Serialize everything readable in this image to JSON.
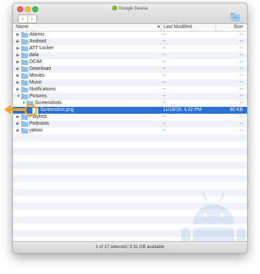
{
  "window": {
    "title": "Google Device"
  },
  "header": {
    "name_label": "Name",
    "modified_label": "Last Modified",
    "size_label": "Size"
  },
  "rows": [
    {
      "name": "Alarms",
      "modified": "--",
      "size": "--",
      "type": "folder",
      "level": 0
    },
    {
      "name": "Android",
      "modified": "--",
      "size": "--",
      "type": "folder",
      "level": 0
    },
    {
      "name": "ATT Locker",
      "modified": "--",
      "size": "--",
      "type": "folder",
      "level": 0
    },
    {
      "name": "data",
      "modified": "--",
      "size": "--",
      "type": "folder",
      "level": 0
    },
    {
      "name": "DCIM",
      "modified": "--",
      "size": "--",
      "type": "folder",
      "level": 0
    },
    {
      "name": "Download",
      "modified": "--",
      "size": "--",
      "type": "folder",
      "level": 0
    },
    {
      "name": "Movies",
      "modified": "--",
      "size": "--",
      "type": "folder",
      "level": 0
    },
    {
      "name": "Music",
      "modified": "--",
      "size": "--",
      "type": "folder",
      "level": 0
    },
    {
      "name": "Notifications",
      "modified": "--",
      "size": "--",
      "type": "folder",
      "level": 0
    },
    {
      "name": "Pictures",
      "modified": "--",
      "size": "--",
      "type": "folder",
      "level": 0,
      "expanded": true
    },
    {
      "name": "Screenshots",
      "modified": "--",
      "size": "--",
      "type": "folder",
      "level": 1,
      "expanded": true
    },
    {
      "name": "Screenshot.png",
      "modified": "11/19/15, 4:32 PM",
      "size": "80 KB",
      "type": "file",
      "level": 2,
      "selected": true
    },
    {
      "name": "Playlists",
      "modified": "--",
      "size": "--",
      "type": "folder",
      "level": 0
    },
    {
      "name": "Podcasts",
      "modified": "--",
      "size": "--",
      "type": "folder",
      "level": 0
    },
    {
      "name": "yahoo",
      "modified": "--",
      "size": "--",
      "type": "folder",
      "level": 0
    }
  ],
  "status": {
    "text": "1 of 17 selected, 9.31 GB available"
  },
  "colors": {
    "selection": "#2a6fd6",
    "folder": "#8fc2ea",
    "stripe": "#eef3fa",
    "callout": "#f5a623"
  }
}
